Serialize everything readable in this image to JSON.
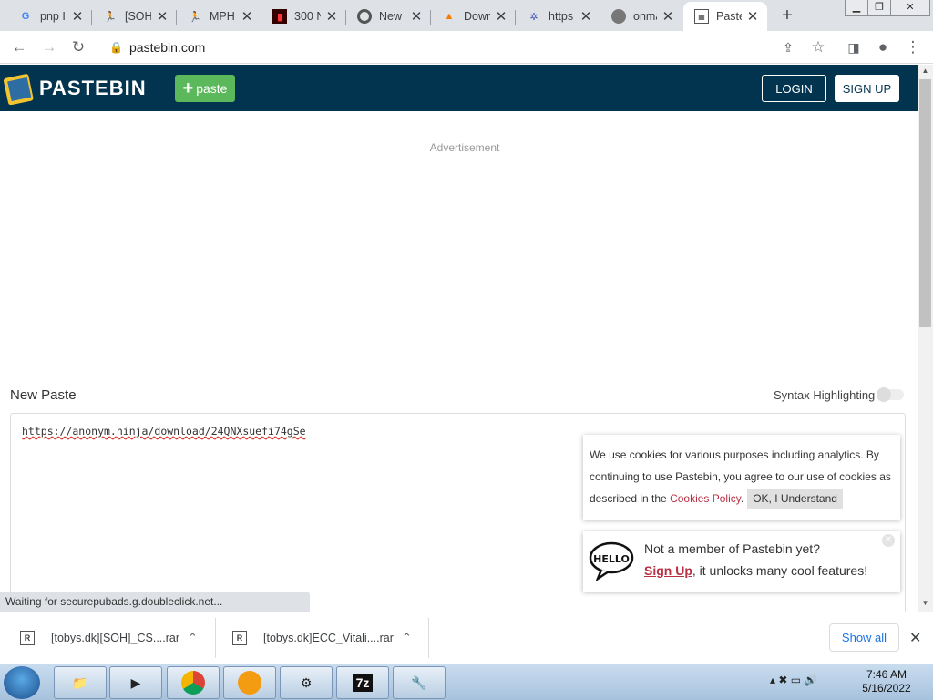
{
  "browser": {
    "tabs": [
      {
        "title": "pnp I",
        "icon": "google-icon"
      },
      {
        "title": "[SOH",
        "icon": "cs-icon"
      },
      {
        "title": "MPH",
        "icon": "cs-icon"
      },
      {
        "title": "300 N",
        "icon": "site-icon"
      },
      {
        "title": "New",
        "icon": "chrome-icon"
      },
      {
        "title": "Dowr",
        "icon": "fire-icon"
      },
      {
        "title": "https",
        "icon": "bug-icon"
      },
      {
        "title": "onma",
        "icon": "globe-icon"
      },
      {
        "title": "Paste",
        "icon": "pastebin-icon"
      }
    ],
    "address": "pastebin.com",
    "status_text": "Waiting for securepubads.g.doubleclick.net..."
  },
  "header": {
    "brand": "PASTEBIN",
    "paste_label": "paste",
    "login_label": "LOGIN",
    "signup_label": "SIGN UP",
    "color": "#02344f",
    "paste_color": "#5bb85b"
  },
  "main": {
    "ad_label": "Advertisement",
    "new_paste_title": "New Paste",
    "syntax_label": "Syntax Highlighting",
    "paste_content": "https://anonym.ninja/download/24QNXsuefi74gSe"
  },
  "cookie": {
    "text_before": "We use cookies for various purposes including analytics. By continuing to use Pastebin, you agree to our use of cookies as described in the ",
    "link": "Cookies Policy",
    "text_after": ".",
    "ok_label": "OK, I Understand"
  },
  "hello": {
    "badge": "HELLO",
    "line1": "Not a member of Pastebin yet?",
    "signup_link": "Sign Up",
    "line2_rest": ", it unlocks many cool features!"
  },
  "downloads": {
    "items": [
      {
        "name": "[tobys.dk][SOH]_CS....rar"
      },
      {
        "name": "[tobys.dk]ECC_Vitali....rar"
      }
    ],
    "show_all": "Show all"
  },
  "taskbar": {
    "time": "7:46 AM",
    "date": "5/16/2022",
    "seven_zip": "7z"
  }
}
